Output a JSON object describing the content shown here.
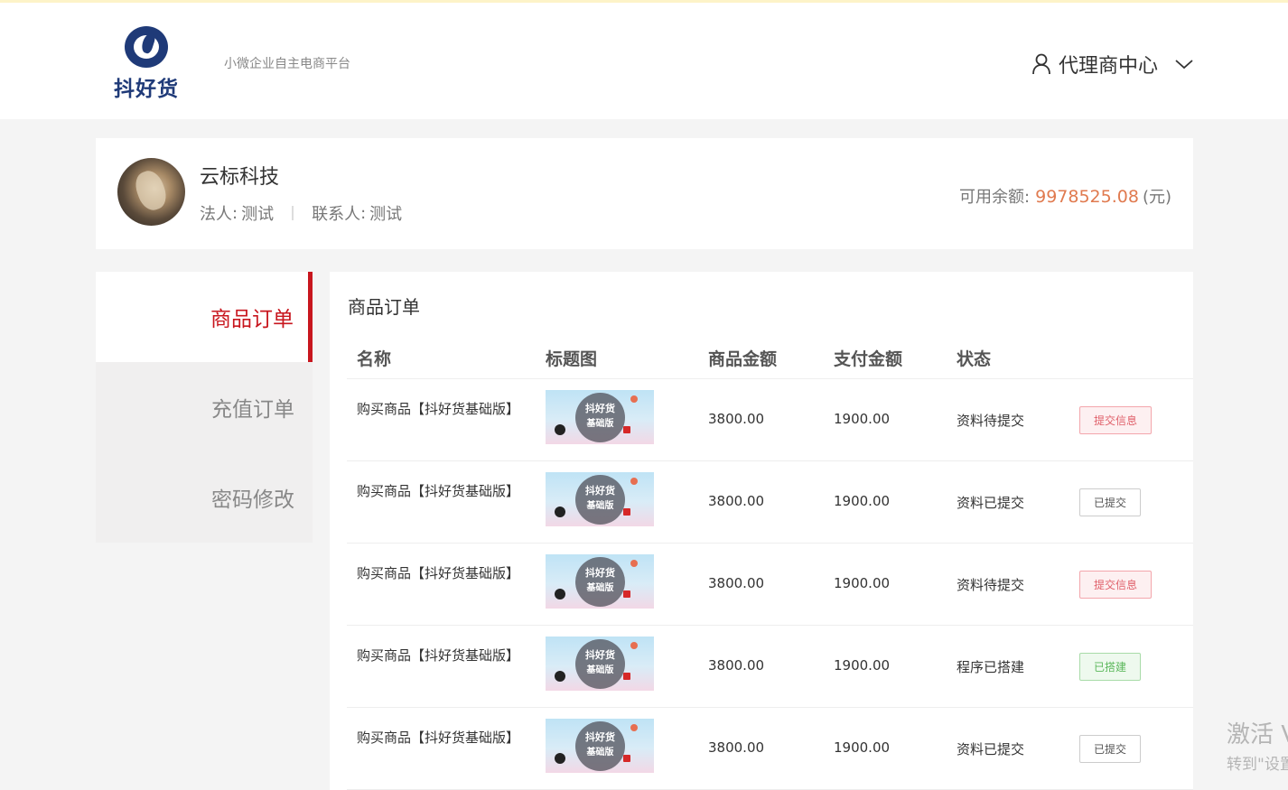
{
  "header": {
    "logo_text": "抖好货",
    "slogan": "小微企业自主电商平台",
    "agent_center": "代理商中心"
  },
  "profile": {
    "company": "云标科技",
    "legal_label": "法人",
    "legal_value": "测试",
    "contact_label": "联系人",
    "contact_value": "测试",
    "balance_label": "可用余额:",
    "balance_amount": "9978525.08",
    "balance_unit": "(元)"
  },
  "sidebar": {
    "items": [
      {
        "label": "商品订单",
        "active": true
      },
      {
        "label": "充值订单",
        "active": false
      },
      {
        "label": "密码修改",
        "active": false
      }
    ]
  },
  "main": {
    "title": "商品订单",
    "columns": [
      "名称",
      "标题图",
      "商品金额",
      "支付金额",
      "状态"
    ],
    "thumb_text_1": "抖好货",
    "thumb_text_2": "基础版",
    "rows": [
      {
        "name": "购买商品【抖好货基础版】",
        "amount": "3800.00",
        "pay": "1900.00",
        "status": "资料待提交",
        "action": "提交信息",
        "action_type": "submit-info"
      },
      {
        "name": "购买商品【抖好货基础版】",
        "amount": "3800.00",
        "pay": "1900.00",
        "status": "资料已提交",
        "action": "已提交",
        "action_type": "submitted"
      },
      {
        "name": "购买商品【抖好货基础版】",
        "amount": "3800.00",
        "pay": "1900.00",
        "status": "资料待提交",
        "action": "提交信息",
        "action_type": "submit-info"
      },
      {
        "name": "购买商品【抖好货基础版】",
        "amount": "3800.00",
        "pay": "1900.00",
        "status": "程序已搭建",
        "action": "已搭建",
        "action_type": "built"
      },
      {
        "name": "购买商品【抖好货基础版】",
        "amount": "3800.00",
        "pay": "1900.00",
        "status": "资料已提交",
        "action": "已提交",
        "action_type": "submitted"
      }
    ]
  },
  "watermark": {
    "line1": "激活 V",
    "line2": "转到\"设置"
  },
  "colors": {
    "accent": "#c8161e",
    "balance": "#e07a4f",
    "brand": "#1f3a78"
  }
}
